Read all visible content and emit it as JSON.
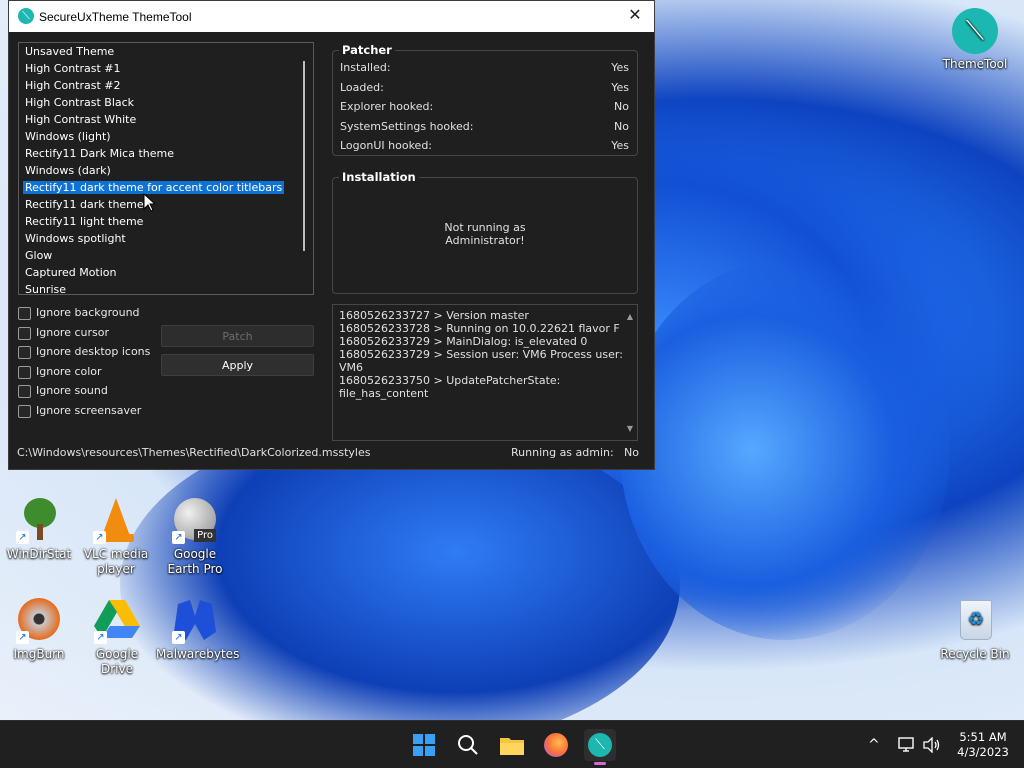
{
  "window": {
    "title": "SecureUxTheme ThemeTool",
    "close_glyph": "✕",
    "app_icon_glyph": "⟍"
  },
  "themes": [
    "Unsaved Theme",
    "High Contrast #1",
    "High Contrast #2",
    "High Contrast Black",
    "High Contrast White",
    "Windows (light)",
    "Rectify11 Dark Mica theme",
    "Windows (dark)",
    "Rectify11 dark theme for accent color titlebars",
    "Rectify11 dark theme",
    "Rectify11 light theme",
    "Windows spotlight",
    "Glow",
    "Captured Motion",
    "Sunrise"
  ],
  "selected_theme_index": 8,
  "options": [
    "Ignore background",
    "Ignore cursor",
    "Ignore desktop icons",
    "Ignore color",
    "Ignore sound",
    "Ignore screensaver"
  ],
  "buttons": {
    "patch": "Patch",
    "apply": "Apply"
  },
  "patcher": {
    "title": "Patcher",
    "rows": [
      {
        "label": "Installed:",
        "value": "Yes"
      },
      {
        "label": "Loaded:",
        "value": "Yes"
      },
      {
        "label": "Explorer hooked:",
        "value": "No"
      },
      {
        "label": "SystemSettings hooked:",
        "value": "No"
      },
      {
        "label": "LogonUI hooked:",
        "value": "Yes"
      }
    ]
  },
  "installation": {
    "title": "Installation",
    "message_line1": "Not running as",
    "message_line2": "Administrator!"
  },
  "log": [
    "1680526233727 > Version master",
    "1680526233728 > Running on 10.0.22621 flavor F",
    "1680526233729 > MainDialog: is_elevated 0",
    "1680526233729 > Session user: VM6 Process user: VM6",
    "1680526233750 > UpdatePatcherState: file_has_content"
  ],
  "status": {
    "path": "C:\\Windows\\resources\\Themes\\Rectified\\DarkColorized.msstyles",
    "admin_label": "Running as admin:",
    "admin_value": "No"
  },
  "desktop_icons": {
    "themetool": "ThemeTool",
    "windirstat": "WinDirStat",
    "vlc": "VLC media player",
    "google_earth": "Google Earth Pro",
    "google_earth_badge": "Pro",
    "imgburn": "ImgBurn",
    "google_drive": "Google Drive",
    "malwarebytes": "Malwarebytes",
    "recycle_bin": "Recycle Bin",
    "shortcut_glyph": "↗"
  },
  "taskbar": {
    "time": "5:51 AM",
    "date": "4/3/2023",
    "chevron_glyph": "^"
  },
  "colors": {
    "accent": "#0f72d3",
    "window_bg": "#1f1f1f",
    "taskbar_bg": "#202020"
  }
}
